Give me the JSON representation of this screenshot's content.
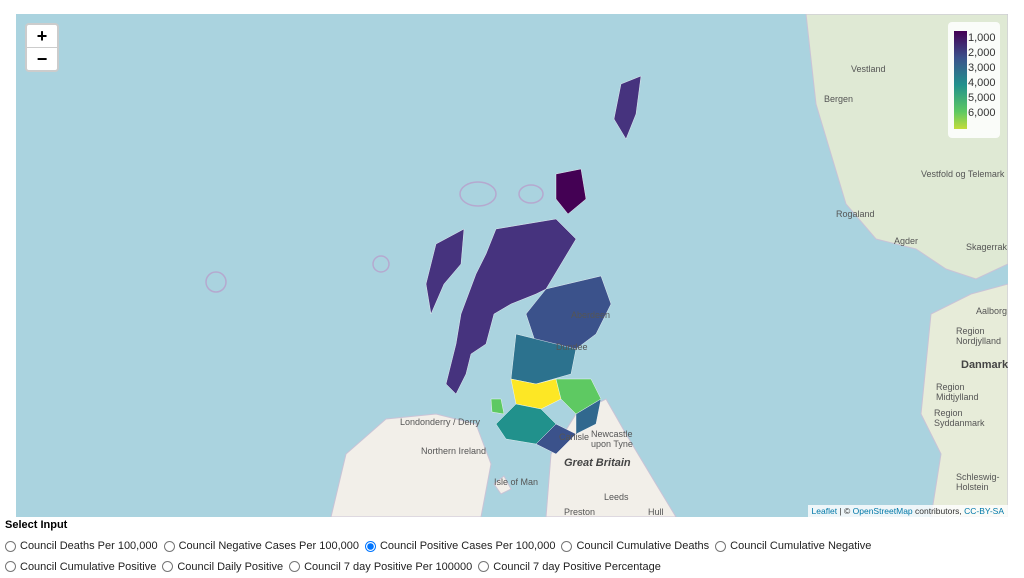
{
  "map": {
    "zoom_in": "+",
    "zoom_out": "−",
    "legend": {
      "ticks": [
        "1,000",
        "2,000",
        "3,000",
        "4,000",
        "5,000",
        "6,000"
      ],
      "colors": [
        "#440154",
        "#3b528b",
        "#21918c",
        "#5ec962",
        "#fde725"
      ]
    },
    "labels": {
      "bergen": "Bergen",
      "vestland": "Vestland",
      "rogaland": "Rogaland",
      "agder": "Agder",
      "vestfold": "Vestfold og Telemark",
      "skagerrak": "Skagerrak",
      "aalborg": "Aalborg",
      "nordjylland": "Region Nordjylland",
      "danmark": "Danmark",
      "midtjylland": "Region Midtjylland",
      "syddanmark": "Region Syddanmark",
      "schleswig": "Schleswig-Holstein",
      "aberdeen": "Aberdeen",
      "dundee": "Dundee",
      "newcastle": "Newcastle upon Tyne",
      "carlisle": "Carlisle",
      "gb": "Great Britain",
      "derry": "Londonderry / Derry",
      "ni": "Northern Ireland",
      "iom": "Isle of Man",
      "leeds": "Leeds",
      "preston": "Preston",
      "hull": "Hull"
    },
    "attribution": {
      "leaflet": "Leaflet",
      "sep": " | © ",
      "osm": "OpenStreetMap",
      "contrib": " contributors, ",
      "license": "CC-BY-SA"
    }
  },
  "input": {
    "title": "Select Input",
    "selected": "Council Positive Cases Per 100,000",
    "options": [
      "Council Deaths Per 100,000",
      "Council Negative Cases Per 100,000",
      "Council Positive Cases Per 100,000",
      "Council Cumulative Deaths",
      "Council Cumulative Negative",
      "Council Cumulative Positive",
      "Council Daily Positive",
      "Council 7 day Positive Per 100000",
      "Council 7 day Positive Percentage"
    ]
  }
}
